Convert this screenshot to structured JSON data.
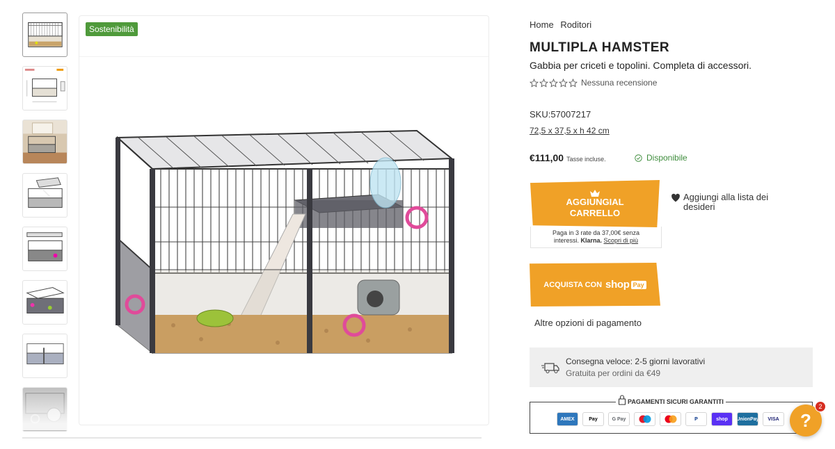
{
  "badge": "Sostenibilità",
  "thumbnails": [
    {
      "name": "thumb-cage-front"
    },
    {
      "name": "thumb-cage-dimensions"
    },
    {
      "name": "thumb-cage-room"
    },
    {
      "name": "thumb-cage-open-top"
    },
    {
      "name": "thumb-cage-open-lid"
    },
    {
      "name": "thumb-cage-angle"
    },
    {
      "name": "thumb-cage-modular"
    },
    {
      "name": "thumb-cage-detail"
    }
  ],
  "breadcrumb": [
    "Home",
    "Roditori"
  ],
  "product": {
    "title": "MULTIPLA HAMSTER",
    "subtitle": "Gabbia per criceti e topolini. Completa di accessori.",
    "rating_text": "Nessuna recensione",
    "stars": 0,
    "sku": "SKU:57007217",
    "dimensions": "72,5 x 37,5 x h 42 cm",
    "price": "€111,00",
    "tax": "Tasse incluse.",
    "availability": "Disponibile"
  },
  "cart": {
    "label": "AGGIUNGIAL CARRELLO",
    "klarna_line1": "Paga in 3 rate da 37,00€ senza",
    "klarna_line2_pre": "interessi.",
    "klarna_brand": "Klarna.",
    "klarna_link": "Scopri di più"
  },
  "wishlist": "Aggiungi alla lista dei desideri",
  "shop_pay": {
    "prefix": "ACQUISTA CON",
    "brand": "shop",
    "pill": "Pay"
  },
  "other_payments": "Altre opzioni di pagamento",
  "delivery": {
    "title": "Consegna veloce: 2-5 giorni lavorativi",
    "subtitle": "Gratuita per ordini da €49"
  },
  "secure_payments": {
    "label": "PAGAMENTI SICURI GARANTITI",
    "methods": [
      {
        "name": "amex-icon",
        "text": "AMEX",
        "bg": "#2e77bc",
        "fg": "#ffffff"
      },
      {
        "name": "apple-pay-icon",
        "text": "Pay",
        "bg": "#ffffff",
        "fg": "#000000"
      },
      {
        "name": "google-pay-icon",
        "text": "G Pay",
        "bg": "#ffffff",
        "fg": "#5f6368"
      },
      {
        "name": "maestro-icon",
        "text": "",
        "bg": "#ffffff",
        "fg": "#000000"
      },
      {
        "name": "mastercard-icon",
        "text": "",
        "bg": "#ffffff",
        "fg": "#000000"
      },
      {
        "name": "paypal-icon",
        "text": "P",
        "bg": "#ffffff",
        "fg": "#003087"
      },
      {
        "name": "shop-pay-icon",
        "text": "shop",
        "bg": "#5a31f4",
        "fg": "#ffffff"
      },
      {
        "name": "unionpay-icon",
        "text": "UnionPay",
        "bg": "#1e6f9f",
        "fg": "#ffffff"
      },
      {
        "name": "visa-icon",
        "text": "VISA",
        "bg": "#ffffff",
        "fg": "#1a1f71"
      }
    ]
  },
  "help": {
    "label": "?",
    "badge": "2"
  },
  "colors": {
    "accent": "#f0a127",
    "badge_green": "#4f9a3b",
    "available_green": "#3f8d3d"
  }
}
